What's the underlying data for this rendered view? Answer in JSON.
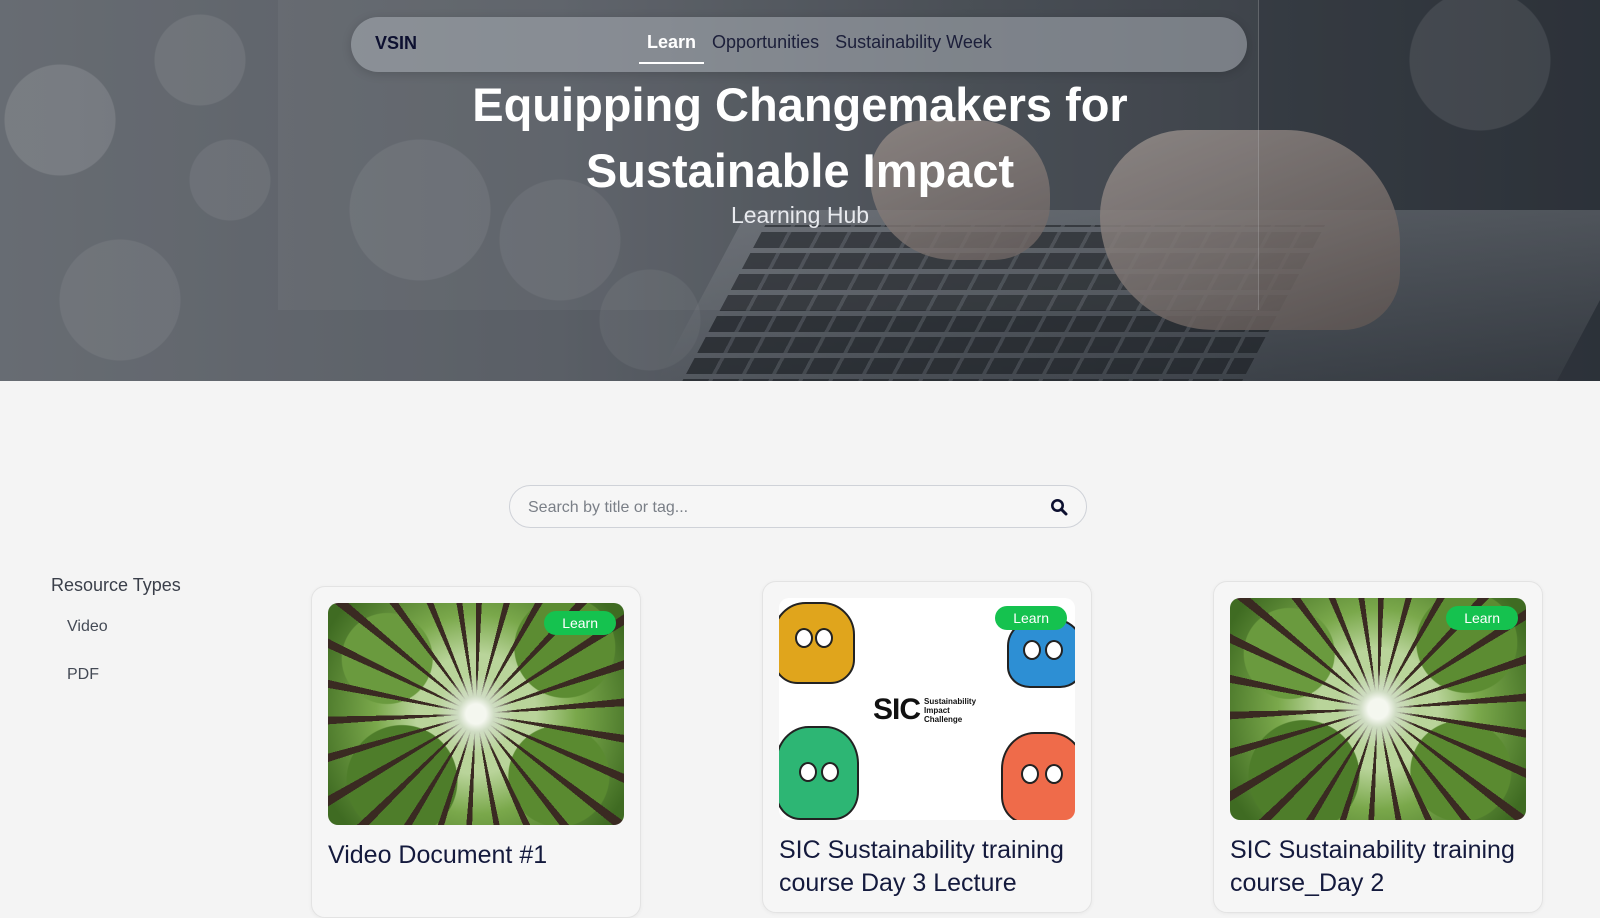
{
  "nav": {
    "brand": "VSIN",
    "links": [
      {
        "label": "Learn",
        "active": true
      },
      {
        "label": "Opportunities",
        "active": false
      },
      {
        "label": "Sustainability Week",
        "active": false
      }
    ]
  },
  "hero": {
    "title": "Equipping Changemakers for Sustainable Impact",
    "subtitle": "Learning Hub"
  },
  "search": {
    "placeholder": "Search by title or tag...",
    "value": "",
    "icon": "search-icon"
  },
  "sidebar": {
    "title": "Resource Types",
    "items": [
      {
        "label": "Video"
      },
      {
        "label": "PDF"
      }
    ]
  },
  "cards": [
    {
      "title": "Video Document #1",
      "badge": "Learn",
      "image": "forest-canopy-image"
    },
    {
      "title": "SIC Sustainability training course Day 3 Lecture",
      "badge": "Learn",
      "image": "sic-mascots-image",
      "logo": {
        "letters": "SIC",
        "line1": "Sustainability",
        "line2": "Impact",
        "line3": "Challenge"
      }
    },
    {
      "title": "SIC Sustainability training course_Day 2",
      "badge": "Learn",
      "image": "forest-canopy-image"
    }
  ],
  "colors": {
    "badge_green": "#15c24f",
    "title_navy": "#141a3d",
    "page_bg": "#f4f4f4"
  }
}
